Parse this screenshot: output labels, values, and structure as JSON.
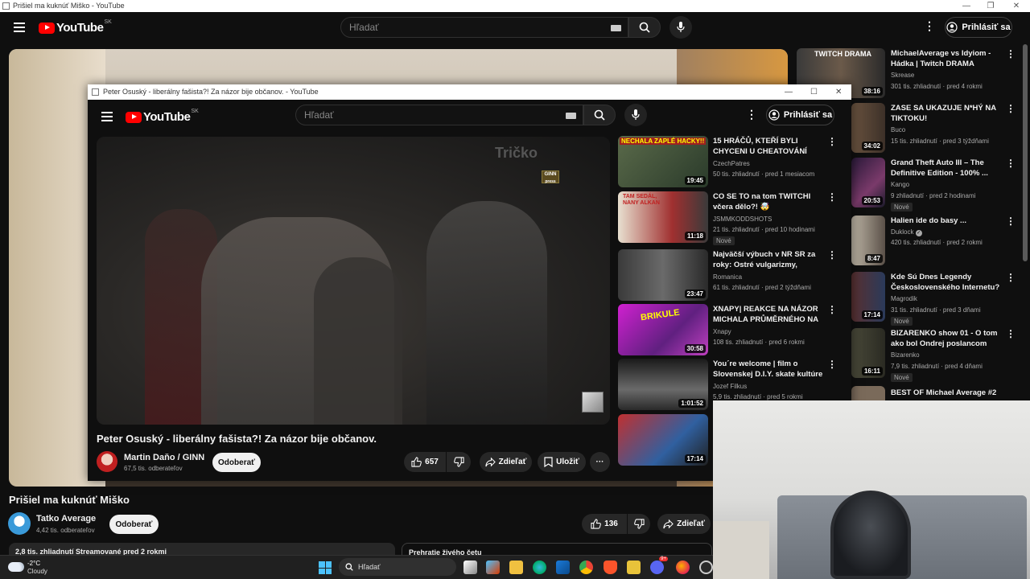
{
  "outer_window": {
    "title": "Prišiel ma kuknúť Miško - YouTube"
  },
  "outer_header": {
    "logo_text": "YouTube",
    "region": "SK",
    "search_placeholder": "Hľadať",
    "signin_label": "Prihlásiť sa"
  },
  "outer_video": {
    "title": "Prišiel ma kuknúť Miško",
    "channel": "Tatko Average",
    "subscribers": "4,42 tis. odberateľov",
    "subscribe_label": "Odoberať",
    "likes": "136",
    "share_label": "Zdieľať",
    "views_line": "2,8 tis. zhliadnutí  Streamované pred 2 rokmi",
    "chat_line": "Prehratie živého četu"
  },
  "outer_recs": [
    {
      "thumb_text": "TWITCH DRAMA",
      "duration": "38:16",
      "title": "MichaelAverage vs Idyiom - Hádka | Twitch DRAMA",
      "channel": "Skrease",
      "meta": "301 tis. zhliadnutí · pred 4 rokmi",
      "badge": ""
    },
    {
      "thumb_text": "",
      "duration": "34:02",
      "title": "ZASE SA UKAZUJE N*HÝ NA TIKTOKU!",
      "channel": "Buco",
      "meta": "15 tis. zhliadnutí · pred 3 týždňami",
      "badge": ""
    },
    {
      "thumb_text": "",
      "duration": "20:53",
      "title": "Grand Theft Auto III – The Definitive Edition - 100% ...",
      "channel": "Kango",
      "meta": "9 zhliadnutí · pred 2 hodinami",
      "badge": "Nové"
    },
    {
      "thumb_text": "",
      "duration": "8:47",
      "title": "Halien ide do basy ...",
      "channel": "Duklock",
      "meta": "420 tis. zhliadnutí · pred 2 rokmi",
      "badge": ""
    },
    {
      "thumb_text": "",
      "duration": "17:14",
      "title": "Kde Sú Dnes Legendy Československého Internetu?",
      "channel": "Magrodik",
      "meta": "31 tis. zhliadnutí · pred 3 dňami",
      "badge": "Nové"
    },
    {
      "thumb_text": "",
      "duration": "16:11",
      "title": "BIZARENKO show 01 - O tom ako bol Ondrej poslancom",
      "channel": "Bizarenko",
      "meta": "7,9 tis. zhliadnutí · pred 4 dňami",
      "badge": "Nové"
    },
    {
      "thumb_text": "",
      "duration": "",
      "title": "BEST OF Michael Average #2",
      "channel": "",
      "meta": "",
      "badge": ""
    }
  ],
  "inner_window": {
    "title": "Peter Osuský - liberálny fašista?! Za názor bije občanov. - YouTube"
  },
  "inner_header": {
    "logo_text": "YouTube",
    "region": "SK",
    "search_placeholder": "Hľadať",
    "signin_label": "Prihlásiť sa"
  },
  "inner_video": {
    "watermark": "GINN",
    "watermark_sub": "press",
    "shirt_text": "Tričko",
    "title": "Peter Osuský - liberálny fašista?! Za názor bije občanov.",
    "channel": "Martin Daňo / GINN",
    "subscribers": "67,5 tis. odberateľov",
    "subscribe_label": "Odoberať",
    "likes": "657",
    "share_label": "Zdieľať",
    "save_label": "Uložiť"
  },
  "inner_recs": [
    {
      "thumb_text": "NECHALA ZAPLÉ HACKY!!",
      "duration": "19:45",
      "title": "15 HRÁČŮ, KTEŘÍ BYLI CHYCENI U CHEATOVÁNÍ",
      "channel": "CzechPatres",
      "meta": "50 tis. zhliadnutí · pred 1 mesiacom",
      "badge": ""
    },
    {
      "thumb_text": "TAM SEDÁL, NANY ALKAN",
      "duration": "11:18",
      "title": "CO SE TO na tom TWITCHI včera dělo?! 🤯",
      "channel": "JSMMKODDSHOTS",
      "meta": "21 tis. zhliadnutí · pred 10 hodinami",
      "badge": "Nové"
    },
    {
      "thumb_text": "",
      "duration": "23:47",
      "title": "Najväčší výbuch v NR SR za roky: Ostré vulgarizmy, potýčk...",
      "channel": "Romanica",
      "meta": "61 tis. zhliadnutí · pred 2 týždňami",
      "badge": ""
    },
    {
      "thumb_text": "BRIKULE",
      "duration": "30:58",
      "title": "XNAPY| REAKCE NA NÁZOR MICHALA PRŮMĚRNÉHO NA ...",
      "channel": "Xnapy",
      "meta": "108 tis. zhliadnutí · pred 6 rokmi",
      "badge": ""
    },
    {
      "thumb_text": "",
      "duration": "1:01:52",
      "title": "You´re welcome | film o Slovenskej D.I.Y. skate kultúre",
      "channel": "Jozef Filkus",
      "meta": "5,9 tis. zhliadnutí · pred 5 rokmi",
      "badge": ""
    },
    {
      "thumb_text": "",
      "duration": "17:14",
      "title": "",
      "channel": "",
      "meta": "",
      "badge": ""
    }
  ],
  "taskbar": {
    "weather_temp": "-2°C",
    "weather_desc": "Cloudy",
    "search_label": "Hľadať",
    "discord_badge": "9+"
  },
  "colors": {
    "youtube_red": "#ff0000",
    "background": "#0f0f0f",
    "surface": "#272727",
    "taskbar": "#202020"
  }
}
